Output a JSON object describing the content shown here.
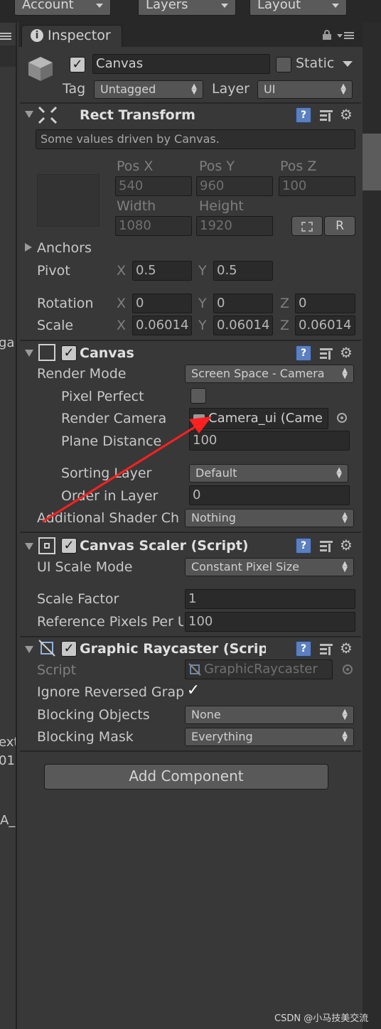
{
  "toolbar": {
    "account_label": "Account",
    "layers_label": "Layers",
    "layout_label": "Layout"
  },
  "left_panel": {
    "fragments": [
      "ga",
      "ext",
      "01",
      "A_"
    ]
  },
  "inspector": {
    "tab_label": "Inspector",
    "object": {
      "active": true,
      "name": "Canvas",
      "static_label": "Static",
      "static_checked": false,
      "tag_label": "Tag",
      "tag_value": "Untagged",
      "layer_label": "Layer",
      "layer_value": "UI"
    },
    "rect_transform": {
      "title": "Rect Transform",
      "info": "Some values driven by Canvas.",
      "pos_x_label": "Pos X",
      "pos_y_label": "Pos Y",
      "pos_z_label": "Pos Z",
      "pos_x": "540",
      "pos_y": "960",
      "pos_z": "100",
      "width_label": "Width",
      "height_label": "Height",
      "width": "1080",
      "height": "1920",
      "r_button": "R",
      "anchors_label": "Anchors",
      "pivot_label": "Pivot",
      "pivot_x": "0.5",
      "pivot_y": "0.5",
      "rotation_label": "Rotation",
      "rot_x": "0",
      "rot_y": "0",
      "rot_z": "0",
      "scale_label": "Scale",
      "scale_x": "0.06014",
      "scale_y": "0.06014",
      "scale_z": "0.06014",
      "axis_x": "X",
      "axis_y": "Y",
      "axis_z": "Z"
    },
    "canvas": {
      "title": "Canvas",
      "render_mode_label": "Render Mode",
      "render_mode": "Screen Space - Camera",
      "pixel_perfect_label": "Pixel Perfect",
      "pixel_perfect": false,
      "render_camera_label": "Render Camera",
      "render_camera": "Camera_ui (Came",
      "plane_distance_label": "Plane Distance",
      "plane_distance": "100",
      "sorting_layer_label": "Sorting Layer",
      "sorting_layer": "Default",
      "order_label": "Order in Layer",
      "order": "0",
      "shader_label": "Additional Shader Ch",
      "shader_value": "Nothing"
    },
    "canvas_scaler": {
      "title": "Canvas Scaler (Script)",
      "mode_label": "UI Scale Mode",
      "mode": "Constant Pixel Size",
      "scale_factor_label": "Scale Factor",
      "scale_factor": "1",
      "ref_ppu_label": "Reference Pixels Per U",
      "ref_ppu": "100"
    },
    "raycaster": {
      "title": "Graphic Raycaster (Scrip",
      "script_label": "Script",
      "script": "GraphicRaycaster",
      "ignore_label": "Ignore Reversed Grap",
      "ignore": true,
      "blocking_objects_label": "Blocking Objects",
      "blocking_objects": "None",
      "blocking_mask_label": "Blocking Mask",
      "blocking_mask": "Everything"
    },
    "add_component": "Add Component"
  },
  "watermark": "CSDN @小马技美交流",
  "annotation": {
    "arrow_color": "#ff2020"
  }
}
